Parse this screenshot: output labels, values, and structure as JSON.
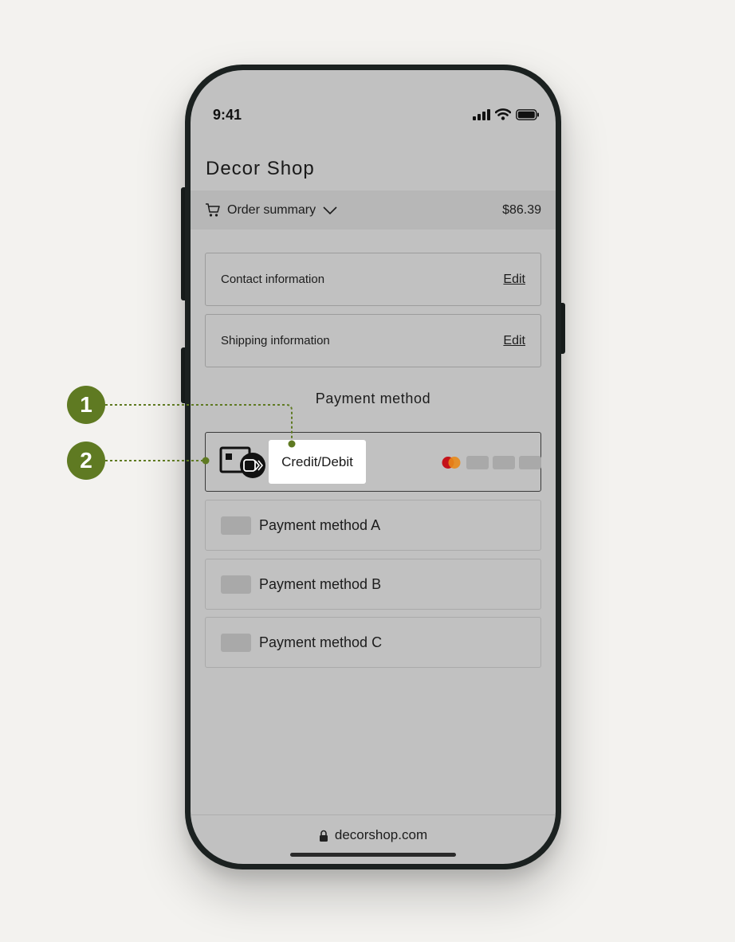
{
  "status_bar": {
    "time": "9:41"
  },
  "header": {
    "shop_title": "Decor Shop"
  },
  "order_summary": {
    "label": "Order summary",
    "total": "$86.39"
  },
  "sections": [
    {
      "label": "Contact information",
      "action": "Edit"
    },
    {
      "label": "Shipping information",
      "action": "Edit"
    }
  ],
  "payment": {
    "heading": "Payment method",
    "selected_label": "Credit/Debit",
    "methods": [
      "Payment method A",
      "Payment method B",
      "Payment method C"
    ]
  },
  "browser": {
    "url": "decorshop.com"
  },
  "callouts": [
    "1",
    "2"
  ],
  "colors": {
    "callout": "#5f7a22",
    "screen": "#c1c1c1",
    "frame": "#1b2120"
  }
}
